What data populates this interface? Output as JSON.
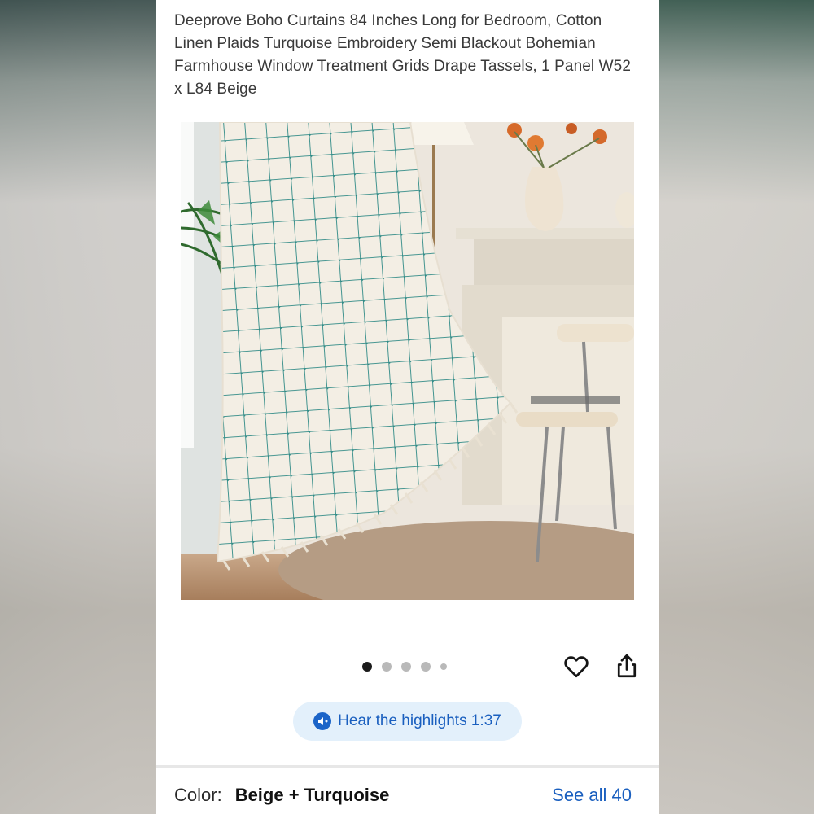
{
  "product": {
    "title": "Deeprove Boho Curtains 84 Inches Long for Bedroom, Cotton Linen Plaids Turquoise Embroidery Semi Blackout Bohemian Farmhouse Window Treatment Grids Drape Tassels, 1 Panel W52 x L84 Beige"
  },
  "gallery": {
    "image_description_icon": "product-photo",
    "dot_count": 5,
    "active_index": 0
  },
  "actions": {
    "heart_icon": "heart-icon",
    "share_icon": "share-icon"
  },
  "highlights": {
    "label": "Hear the highlights 1:37",
    "icon": "audio-icon"
  },
  "variation": {
    "label": "Color:",
    "value": "Beige + Turquoise",
    "see_all": "See all 40"
  },
  "colors": {
    "link_blue": "#1a5fbf",
    "pill_bg": "#e3f0fb",
    "turquoise": "#2f8a86"
  }
}
